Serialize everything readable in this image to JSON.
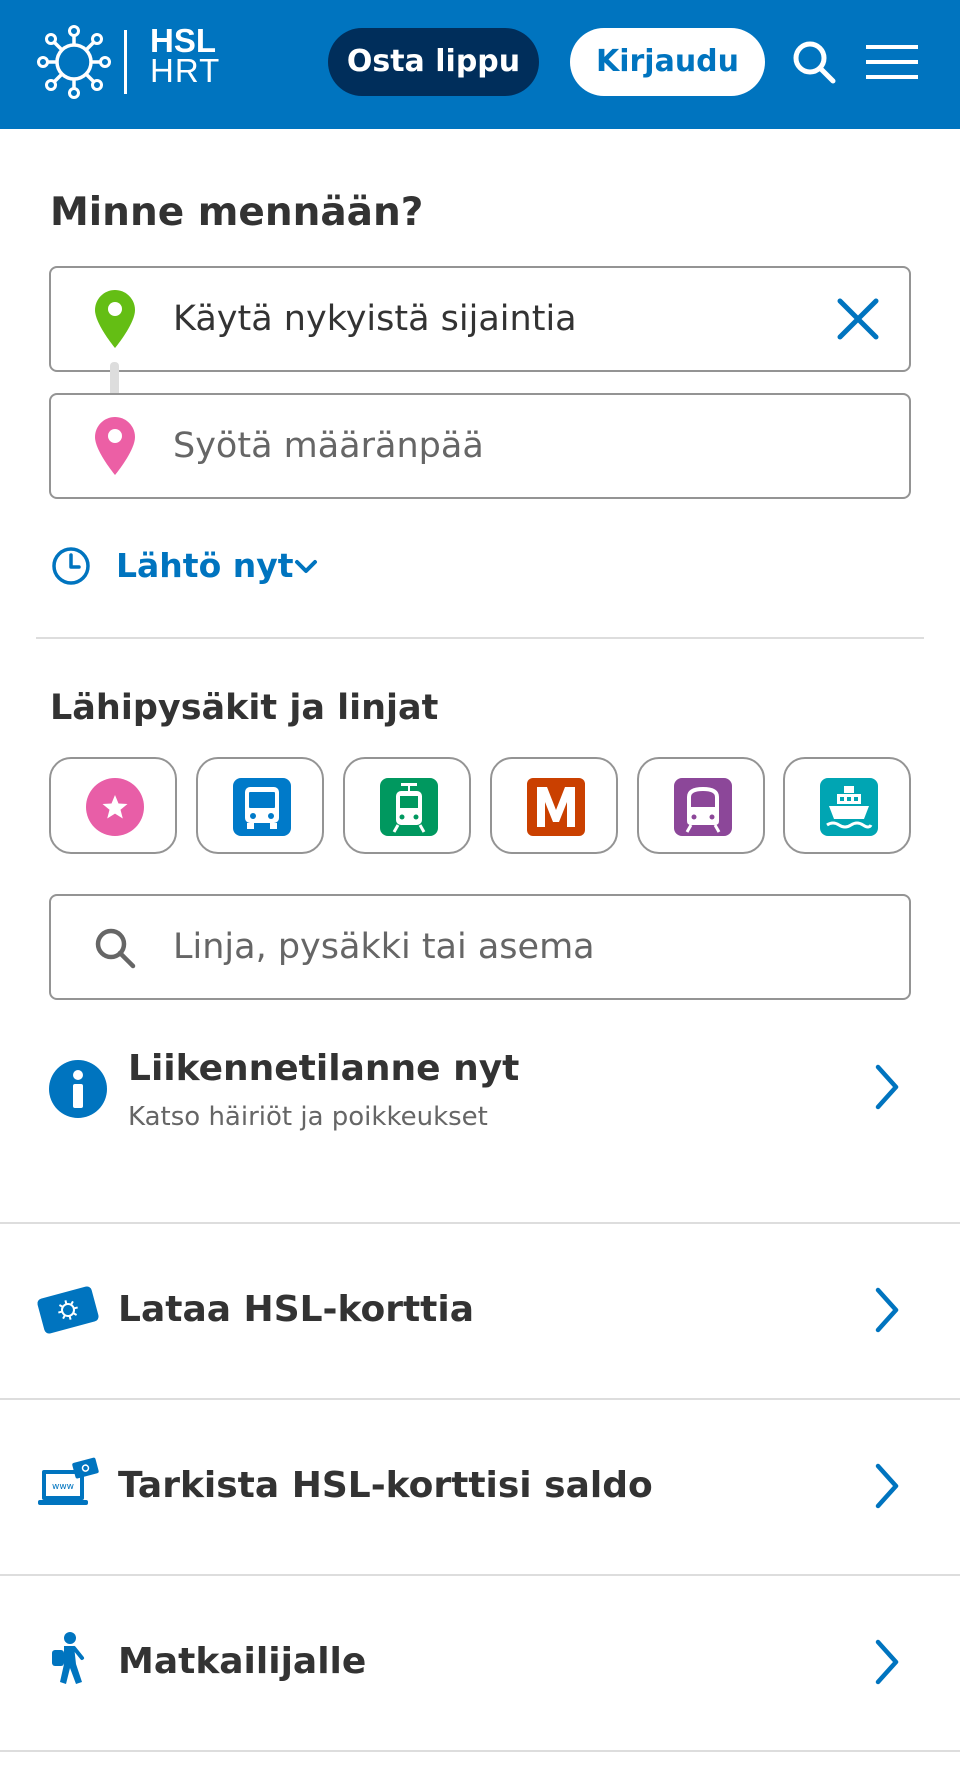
{
  "header": {
    "logo_top": "HSL",
    "logo_bottom": "HRT",
    "buy_ticket_label": "Osta lippu",
    "login_label": "Kirjaudu",
    "search_icon": "search-icon",
    "menu_icon": "hamburger-menu-icon",
    "brand_color": "#0074bf",
    "dark_button_color": "#002e5b"
  },
  "planner": {
    "title": "Minne mennään?",
    "origin_value": "Käytä nykyistä sijaintia",
    "destination_placeholder": "Syötä määränpää",
    "departure_label": "Lähtö nyt",
    "origin_pin_color": "#64be14",
    "destination_pin_color": "#ec5fa5"
  },
  "nearby": {
    "title": "Lähipysäkit ja linjat",
    "modes": [
      {
        "icon": "favourite-star-icon",
        "color": "#e85ea7"
      },
      {
        "icon": "bus-icon",
        "color": "#007ac9"
      },
      {
        "icon": "tram-icon",
        "color": "#00985f"
      },
      {
        "icon": "metro-icon",
        "color": "#ca4000"
      },
      {
        "icon": "train-icon",
        "color": "#8c4799"
      },
      {
        "icon": "ferry-icon",
        "color": "#00a5b3"
      }
    ],
    "search_placeholder": "Linja, pysäkki tai asema"
  },
  "traffic": {
    "title": "Liikennetilanne nyt",
    "subtitle": "Katso häiriöt ja poikkeukset"
  },
  "links": [
    {
      "label": "Lataa HSL-korttia",
      "icon": "hsl-card-icon"
    },
    {
      "label": "Tarkista HSL-korttisi saldo",
      "icon": "laptop-www-icon"
    },
    {
      "label": "Matkailijalle",
      "icon": "traveller-icon"
    }
  ]
}
